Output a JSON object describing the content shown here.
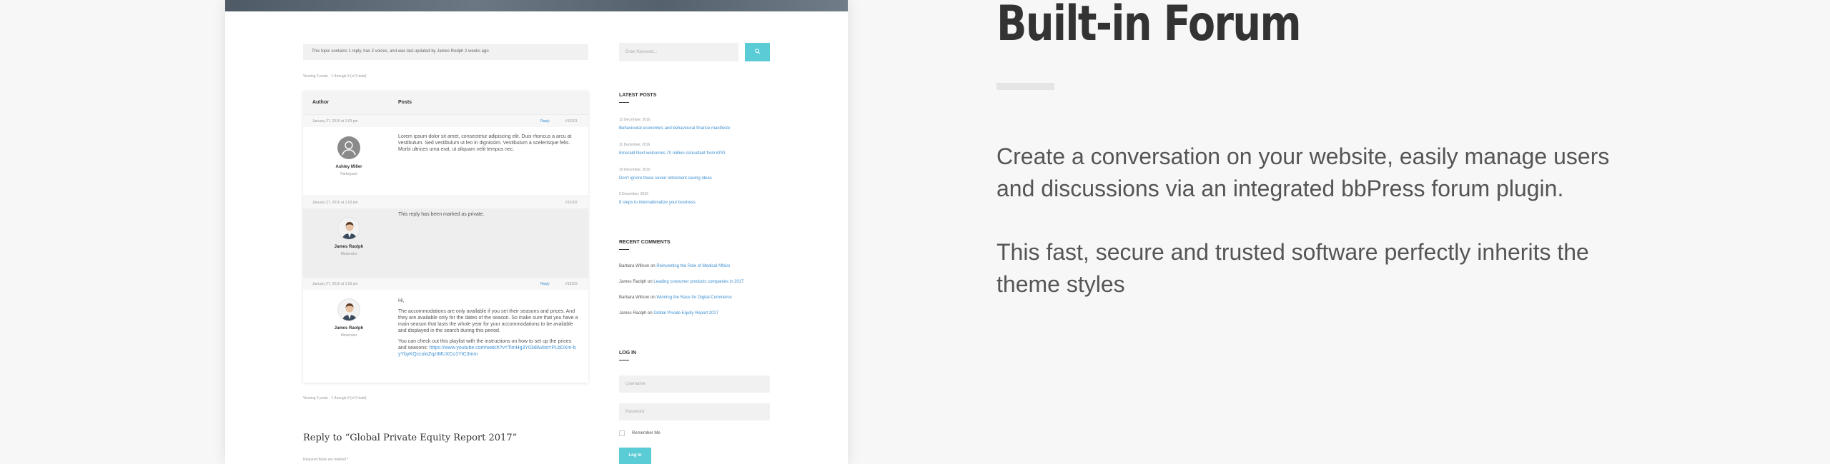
{
  "forum": {
    "topic_info": "This topic contains 1 reply, has 2 voices, and was last updated by James Rodph 2 weeks ago",
    "viewing_top": "Viewing 3 posts - 1 through 3 (of 3 total)",
    "viewing_bottom": "Viewing 3 posts - 1 through 3 (of 3 total)",
    "headers": {
      "author": "Author",
      "posts": "Posts"
    },
    "posts": [
      {
        "date": "January 27, 2016 at 1:03 pm",
        "reply": "Reply",
        "id": "#10201",
        "author": "Ashley Miller",
        "role": "Participant",
        "paragraphs": [
          "Lorem ipsum dolor sit amet, consectetur adipiscing elit. Duis rhoncus a arcu at vestibulum. Sed vestibulum ut leo in dignissim. Vestibulum a scelerisque felis. Morbi ultrices urna erat, ut aliquam velit tempus nec."
        ]
      },
      {
        "date": "January 27, 2016 at 1:03 pm",
        "id": "#10202",
        "author": "James Raolph",
        "role": "Moderator",
        "paragraphs": [
          "This reply has been marked as private."
        ]
      },
      {
        "date": "January 27, 2016 at 1:03 pm",
        "reply": "Reply",
        "id": "#10203",
        "author": "James Raolph",
        "role": "Moderator",
        "p1": "Hi,",
        "p2": "The accommodations are only available if you set their seasons and prices. And they are available only for the dates of the season. So make sure that you have a main season that lasts the whole year for your accommodations to be available and displayed in the search during this period.",
        "p3_text": "You can check out this playlist with the instructions on how to set up the prices and seasons: ",
        "p3_link": "https://www.youtube.com/watch?v=TimHg3Y03dAvlist=PLbDXm-byYbyKQccoloZqzIMUXCo1YtC3mm"
      }
    ],
    "reply_title": "Reply to “Global Private Equity Report 2017”",
    "required_note": "Required fields are marked *"
  },
  "sidebar": {
    "search_placeholder": "Enter Keyword...",
    "search_icon": "search-icon",
    "latest_title": "LATEST POSTS",
    "latest": [
      {
        "date": "12 December, 2016",
        "title": "Behavioural economics and behavioural finance manifesto"
      },
      {
        "date": "11 December, 2016",
        "title": "Emerald Next welcomes 70 million consultant from KPG"
      },
      {
        "date": "10 December, 2016",
        "title": "Don't ignore those seven retirement saving ideas"
      },
      {
        "date": "9 December, 2016",
        "title": "8 steps to internationalize your business"
      }
    ],
    "comments_title": "RECENT COMMENTS",
    "comments": [
      {
        "author": "Barbara Willson",
        "on": " on ",
        "post": "Reinventing the Role of Medical Affairs"
      },
      {
        "author": "James Raolph",
        "on": " on ",
        "post": "Leading consumer products companies in 2017"
      },
      {
        "author": "Barbara Willson",
        "on": " on ",
        "post": "Winning the Race for Digital Commerce"
      },
      {
        "author": "James Raolph",
        "on": " on ",
        "post": "Global Private Equity Report 2017"
      }
    ],
    "login_title": "LOG IN",
    "username_placeholder": "Username",
    "password_placeholder": "Password",
    "remember_label": "Remember Me",
    "login_button": "Log In"
  },
  "feature": {
    "title": "Built-in Forum",
    "paragraph1": "Create a conversation on your website, easily manage users and discussions via an integrated bbPress forum plugin.",
    "paragraph2": "This fast, secure and trusted software perfectly inherits the theme styles"
  },
  "colors": {
    "accent": "#59ccd6",
    "link": "#3d8fd1",
    "heading": "#333333"
  }
}
